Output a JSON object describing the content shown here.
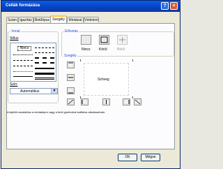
{
  "window": {
    "title": "Cellák formázása",
    "help_glyph": "?",
    "close_glyph": "×"
  },
  "tabs": [
    {
      "label": "Szám"
    },
    {
      "label": "Igazítás"
    },
    {
      "label": "Betűtípus"
    },
    {
      "label": "Szegély",
      "active": true
    },
    {
      "label": "Mintázat"
    },
    {
      "label": "Védelem"
    }
  ],
  "line_group": {
    "title": "Vonal",
    "style_label": "Stílus",
    "none_label": "Nincs",
    "color_label": "Szín:",
    "color_value": "Automatikus"
  },
  "presets_group": {
    "title": "Elősztás",
    "none_label": "Nincs",
    "outline_label": "Körül",
    "inside_label": "Belül"
  },
  "border_group": {
    "title": "Szegély",
    "preview_text": "Szöveg"
  },
  "note": "A kijelölt vonalstílus a mintaképre vagy a fenti gombokra kattintva alkalmazható.",
  "buttons": {
    "ok": "OK",
    "cancel": "Mégse"
  },
  "colors": {
    "titlebar": "#0a5ce8",
    "tab_highlight": "#ffc83c",
    "group_title": "#1e50c8"
  }
}
